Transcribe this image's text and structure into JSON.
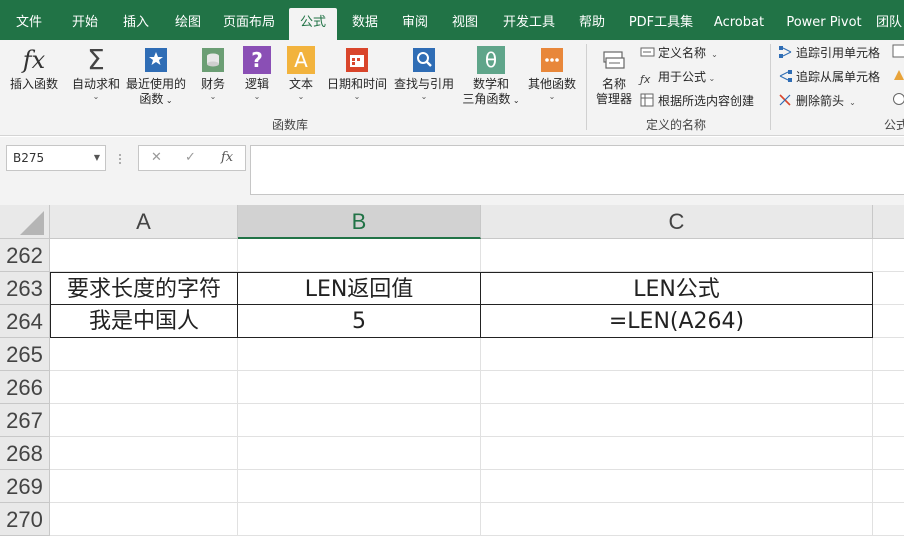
{
  "menu": {
    "tabs": [
      {
        "label": "文件",
        "active": false
      },
      {
        "label": "开始",
        "active": false
      },
      {
        "label": "插入",
        "active": false
      },
      {
        "label": "绘图",
        "active": false
      },
      {
        "label": "页面布局",
        "active": false
      },
      {
        "label": "公式",
        "active": true
      },
      {
        "label": "数据",
        "active": false
      },
      {
        "label": "审阅",
        "active": false
      },
      {
        "label": "视图",
        "active": false
      },
      {
        "label": "开发工具",
        "active": false
      },
      {
        "label": "帮助",
        "active": false
      },
      {
        "label": "PDF工具集",
        "active": false
      },
      {
        "label": "Acrobat",
        "active": false
      },
      {
        "label": "Power Pivot",
        "active": false
      },
      {
        "label": "团队",
        "active": false
      }
    ]
  },
  "ribbon": {
    "function_library": {
      "insert_function": "插入函数",
      "autosum": "自动求和",
      "recent_line1": "最近使用的",
      "recent_line2": "函数",
      "financial": "财务",
      "logical": "逻辑",
      "text": "文本",
      "datetime": "日期和时间",
      "lookup": "查找与引用",
      "math_line1": "数学和",
      "math_line2": "三角函数",
      "more": "其他函数",
      "group_label": "函数库",
      "fx_glyph": "fx",
      "sigma_glyph": "Σ",
      "logical_glyph": "?",
      "text_glyph": "A",
      "math_glyph": "θ"
    },
    "defined_names": {
      "name_manager_line1": "名称",
      "name_manager_line2": "管理器",
      "define_name": "定义名称",
      "use_in_formula": "用于公式",
      "create_from_selection": "根据所选内容创建",
      "group_label": "定义的名称"
    },
    "formula_auditing": {
      "trace_precedents": "追踪引用单元格",
      "trace_dependents": "追踪从属单元格",
      "remove_arrows": "删除箭头",
      "group_label_partial": "公式"
    }
  },
  "formula_bar": {
    "name_box": "B275",
    "cancel_glyph": "✕",
    "enter_glyph": "✓",
    "fx_glyph": "fx",
    "formula": ""
  },
  "sheet": {
    "columns": [
      "A",
      "B",
      "C"
    ],
    "selected_column": "B",
    "rows": [
      {
        "num": "262",
        "A": "",
        "B": "",
        "C": ""
      },
      {
        "num": "263",
        "A": "要求长度的字符",
        "B": "LEN返回值",
        "C": "LEN公式"
      },
      {
        "num": "264",
        "A": "我是中国人",
        "B": "5",
        "C": "=LEN(A264)"
      },
      {
        "num": "265",
        "A": "",
        "B": "",
        "C": ""
      },
      {
        "num": "266",
        "A": "",
        "B": "",
        "C": ""
      },
      {
        "num": "267",
        "A": "",
        "B": "",
        "C": ""
      },
      {
        "num": "268",
        "A": "",
        "B": "",
        "C": ""
      },
      {
        "num": "269",
        "A": "",
        "B": "",
        "C": ""
      },
      {
        "num": "270",
        "A": "",
        "B": "",
        "C": ""
      }
    ]
  },
  "colors": {
    "accent": "#217346",
    "ribbon_bg": "#f3f3f3",
    "header_bg": "#e9e9e9"
  }
}
